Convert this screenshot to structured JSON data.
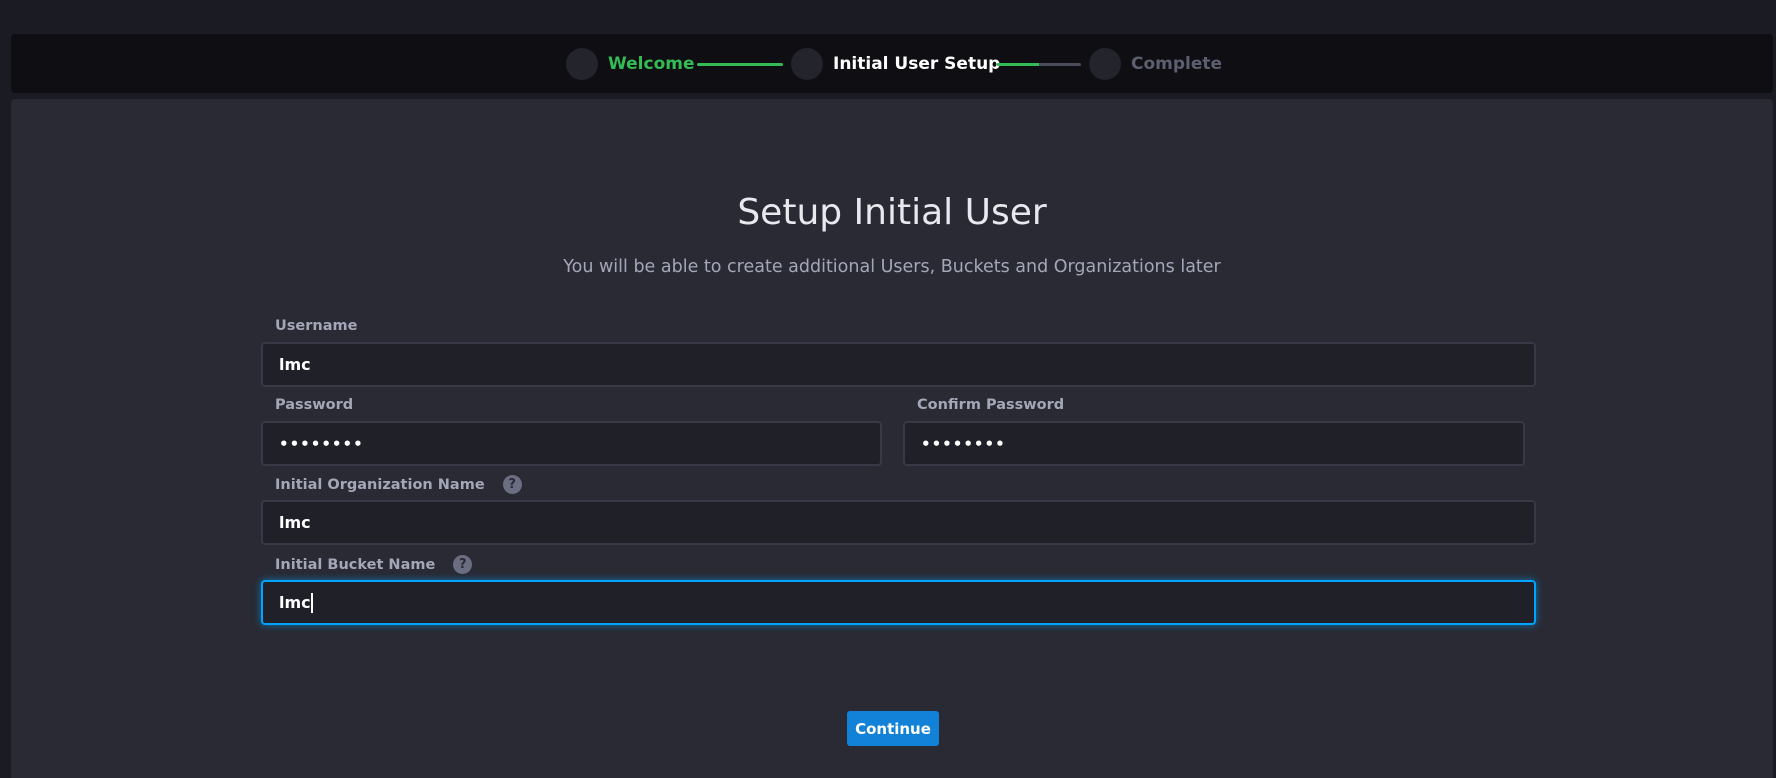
{
  "stepper": {
    "steps": [
      {
        "label": "Welcome",
        "state": "done"
      },
      {
        "label": "Initial User Setup",
        "state": "current"
      },
      {
        "label": "Complete",
        "state": "pending"
      }
    ],
    "connector_progress": [
      1.0,
      0.5
    ],
    "colors": {
      "done": "#34bb55",
      "current": "#ffffff",
      "pending": "#5c5f70"
    }
  },
  "form": {
    "title": "Setup Initial User",
    "subtitle": "You will be able to create additional Users, Buckets and Organizations later",
    "fields": {
      "username": {
        "label": "Username",
        "value": "lmc"
      },
      "password": {
        "label": "Password",
        "value": "••••••••"
      },
      "confirm_password": {
        "label": "Confirm Password",
        "value": "••••••••"
      },
      "organization": {
        "label": "Initial Organization Name",
        "value": "lmc",
        "help": "?"
      },
      "bucket": {
        "label": "Initial Bucket Name",
        "value": "lmc",
        "help": "?"
      }
    },
    "continue_label": "Continue"
  },
  "colors": {
    "accent": "#1282d8",
    "focus": "#00a3ff",
    "success": "#34bb55"
  }
}
